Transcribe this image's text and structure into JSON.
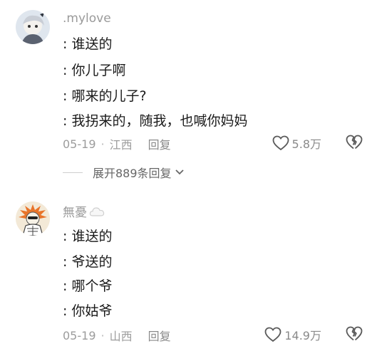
{
  "comments": [
    {
      "username": ".mylove",
      "lines": [
        ": 谁送的",
        ": 你儿子啊",
        ": 哪来的儿子?",
        ": 我拐来的，随我，也喊你妈妈"
      ],
      "date": "05-19",
      "location": "江西",
      "reply_label": "回复",
      "likes": "5.8万"
    },
    {
      "username": "無憂",
      "lines": [
        ": 谁送的",
        ": 爷送的",
        ": 哪个爷",
        ": 你姑爷"
      ],
      "date": "05-19",
      "location": "山西",
      "reply_label": "回复",
      "likes": "14.9万"
    }
  ],
  "expand_replies": "展开889条回复",
  "icons": {
    "like": "heart-outline-icon",
    "dislike": "broken-heart-icon",
    "expand": "chevron-down-icon",
    "user_badge": "cloud-icon"
  },
  "colors": {
    "text": "#1a1a1a",
    "meta": "#9c9c9c",
    "username": "#9a9a9a"
  }
}
